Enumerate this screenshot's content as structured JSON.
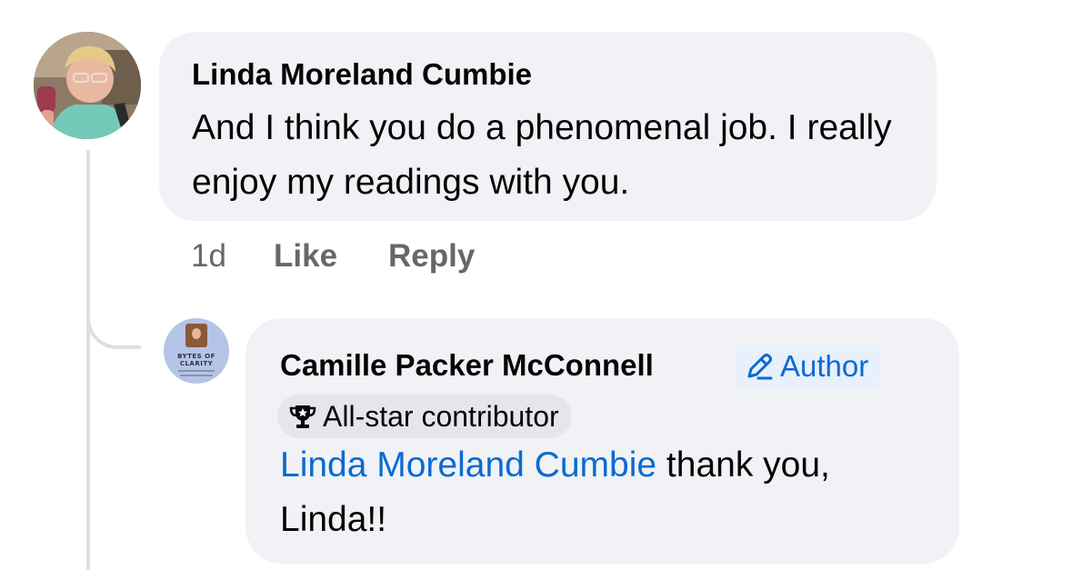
{
  "comment": {
    "author": "Linda Moreland Cumbie",
    "text": "And I think you do a phenomenal job. I really enjoy my readings with you.",
    "time": "1d",
    "like_label": "Like",
    "reply_label": "Reply"
  },
  "reply": {
    "author": "Camille Packer McConnell",
    "author_badge": "Author",
    "contributor_badge": "All-star contributor",
    "mention": "Linda Moreland Cumbie",
    "text": " thank you, Linda!!",
    "avatar_brand": "BYTES OF CLARITY"
  },
  "colors": {
    "bubble": "#f0f2f5",
    "link": "#0b6ad2",
    "muted": "#65676b",
    "thread_line": "#dcdfe3"
  }
}
